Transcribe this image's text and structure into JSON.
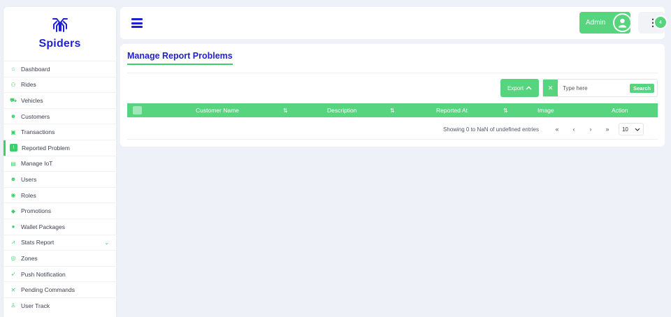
{
  "brand": {
    "name": "Spiders",
    "logo_icon": "spider-logo-icon"
  },
  "sidebar": {
    "items": [
      {
        "label": "Dashboard",
        "icon": "home-icon",
        "glyph": "⌂"
      },
      {
        "label": "Rides",
        "icon": "bike-icon",
        "glyph": "⚇"
      },
      {
        "label": "Vehicles",
        "icon": "car-icon",
        "glyph": "⛟"
      },
      {
        "label": "Customers",
        "icon": "users-icon",
        "glyph": "☻"
      },
      {
        "label": "Transactions",
        "icon": "money-icon",
        "glyph": "▣"
      },
      {
        "label": "Reported Problem",
        "icon": "report-icon",
        "glyph": "!"
      },
      {
        "label": "Manage IoT",
        "icon": "iot-icon",
        "glyph": "▤"
      },
      {
        "label": "Users",
        "icon": "users-icon",
        "glyph": "☻"
      },
      {
        "label": "Roles",
        "icon": "eye-icon",
        "glyph": "◉"
      },
      {
        "label": "Promotions",
        "icon": "tag-icon",
        "glyph": "◆"
      },
      {
        "label": "Wallet Packages",
        "icon": "wallet-icon",
        "glyph": "●"
      },
      {
        "label": "Stats Report",
        "icon": "chart-icon",
        "glyph": "⩘"
      },
      {
        "label": "Zones",
        "icon": "location-icon",
        "glyph": "◎"
      },
      {
        "label": "Push Notification",
        "icon": "send-icon",
        "glyph": "➶"
      },
      {
        "label": "Pending Commands",
        "icon": "command-icon",
        "glyph": "✕"
      },
      {
        "label": "User Track",
        "icon": "user-track-icon",
        "glyph": "♙"
      }
    ],
    "active_index": 5,
    "expandable_label": "Stats Report"
  },
  "topbar": {
    "admin_label": "Admin",
    "notification_count": "4"
  },
  "page": {
    "title": "Manage Report Problems"
  },
  "toolbar": {
    "export_label": "Export",
    "clear_label": "✕",
    "search_placeholder": "Type here",
    "search_label": "Search"
  },
  "table": {
    "columns": [
      "Customer Name",
      "Description",
      "Reported At",
      "Image",
      "Action"
    ],
    "sort_glyph": "⇅",
    "rows": []
  },
  "pagination": {
    "info": "Showing 0 to NaN of undefined entries",
    "first": "«",
    "prev": "‹",
    "next": "›",
    "last": "»",
    "per_page": "10"
  },
  "colors": {
    "accent": "#56d47e",
    "brand_blue": "#1f1fd6",
    "background": "#eef1f7"
  }
}
